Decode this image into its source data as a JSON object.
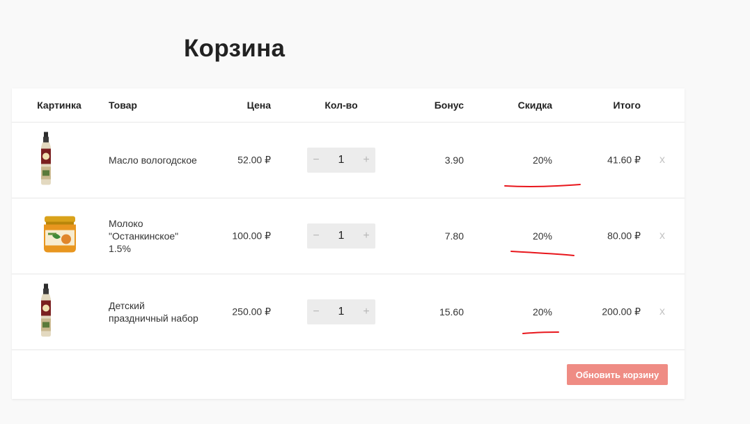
{
  "page": {
    "title": "Корзина"
  },
  "table": {
    "headers": {
      "image": "Картинка",
      "product": "Товар",
      "price": "Цена",
      "qty": "Кол-во",
      "bonus": "Бонус",
      "discount": "Скидка",
      "total": "Итого"
    },
    "rows": [
      {
        "name": "Масло вологодское",
        "price": "52.00 ₽",
        "qty": "1",
        "bonus": "3.90",
        "discount": "20%",
        "total": "41.60 ₽",
        "image_icon": "sauce-bottle-icon"
      },
      {
        "name": "Молоко \"Останкинское\" 1.5%",
        "price": "100.00 ₽",
        "qty": "1",
        "bonus": "7.80",
        "discount": "20%",
        "total": "80.00 ₽",
        "image_icon": "jar-icon"
      },
      {
        "name": "Детский праздничный набор",
        "price": "250.00 ₽",
        "qty": "1",
        "bonus": "15.60",
        "discount": "20%",
        "total": "200.00 ₽",
        "image_icon": "sauce-bottle-icon"
      }
    ],
    "controls": {
      "minus": "−",
      "plus": "+",
      "remove": "x"
    }
  },
  "footer": {
    "update_label": "Обновить корзину"
  },
  "colors": {
    "accent_button": "#ef8c84",
    "annotation_red": "#e8161c"
  }
}
